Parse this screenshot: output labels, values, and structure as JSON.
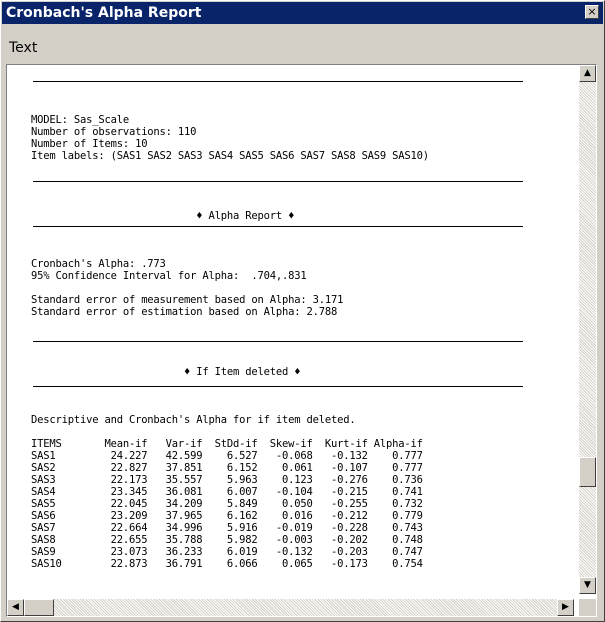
{
  "window": {
    "title": "Cronbach's Alpha Report",
    "close_glyph": "×"
  },
  "menu": {
    "text_label": "Text"
  },
  "report": {
    "model_line": "MODEL: Sas_Scale",
    "obs_line": "Number of observations: 110",
    "items_count_line": "Number of Items: 10",
    "item_labels_line": "Item labels: (SAS1 SAS2 SAS3 SAS4 SAS5 SAS6 SAS7 SAS8 SAS9 SAS10)",
    "alpha_header": "♦ Alpha Report ♦",
    "alpha_line": "Cronbach's Alpha: .773",
    "ci_line": "95% Confidence Interval for Alpha:  .704,.831",
    "sem_line": "Standard error of measurement based on Alpha: 3.171",
    "see_line": "Standard error of estimation based on Alpha: 2.788",
    "deleted_header": "♦ If Item deleted ♦",
    "desc_line": "Descriptive and Cronbach's Alpha for if item deleted.",
    "columns": [
      "ITEMS",
      "Mean-if",
      "Var-if",
      "StDd-if",
      "Skew-if",
      "Kurt-if",
      "Alpha-if"
    ],
    "rows": [
      [
        "SAS1",
        "24.227",
        "42.599",
        "6.527",
        "-0.068",
        "-0.132",
        "0.777"
      ],
      [
        "SAS2",
        "22.827",
        "37.851",
        "6.152",
        "0.061",
        "-0.107",
        "0.777"
      ],
      [
        "SAS3",
        "22.173",
        "35.557",
        "5.963",
        "0.123",
        "-0.276",
        "0.736"
      ],
      [
        "SAS4",
        "23.345",
        "36.081",
        "6.007",
        "-0.104",
        "-0.215",
        "0.741"
      ],
      [
        "SAS5",
        "22.045",
        "34.209",
        "5.849",
        "0.050",
        "-0.255",
        "0.732"
      ],
      [
        "SAS6",
        "23.209",
        "37.965",
        "6.162",
        "0.016",
        "-0.212",
        "0.779"
      ],
      [
        "SAS7",
        "22.664",
        "34.996",
        "5.916",
        "-0.019",
        "-0.228",
        "0.743"
      ],
      [
        "SAS8",
        "22.655",
        "35.788",
        "5.982",
        "-0.003",
        "-0.202",
        "0.748"
      ],
      [
        "SAS9",
        "23.073",
        "36.233",
        "6.019",
        "-0.132",
        "-0.203",
        "0.747"
      ],
      [
        "SAS10",
        "22.873",
        "36.791",
        "6.066",
        "0.065",
        "-0.173",
        "0.754"
      ]
    ]
  },
  "scrollbars": {
    "up_glyph": "▲",
    "down_glyph": "▼",
    "left_glyph": "◀",
    "right_glyph": "▶"
  },
  "colors": {
    "titlebar": "#0a246a",
    "chrome": "#d4d0c8"
  }
}
